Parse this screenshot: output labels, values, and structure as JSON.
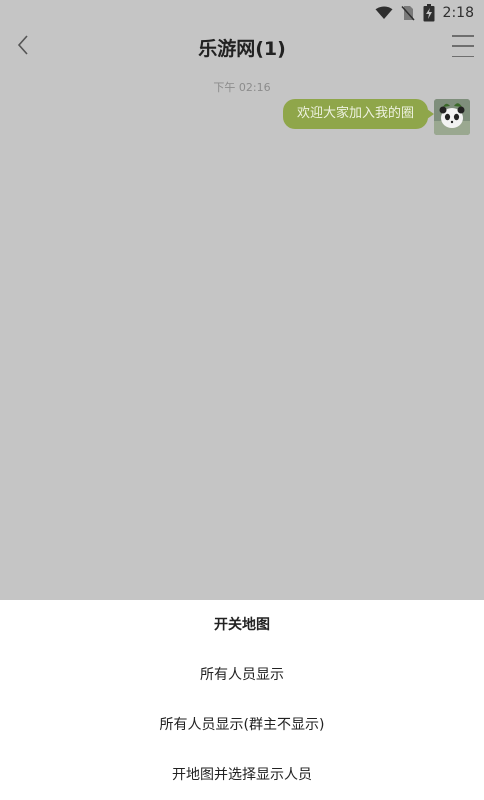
{
  "status_bar": {
    "time": "2:18",
    "icons": [
      "wifi-icon",
      "no-sim-icon",
      "battery-charging-icon"
    ]
  },
  "header": {
    "title": "乐游网(1)",
    "back_icon": "chevron-left-icon",
    "menu_icon": "menu-icon"
  },
  "chat": {
    "timestamp": "下午 02:16",
    "messages": [
      {
        "text": "欢迎大家加入我的圈",
        "from": "self",
        "bubble_color": "#8fa64a"
      }
    ]
  },
  "action_sheet": {
    "items": [
      {
        "label": "开关地图"
      },
      {
        "label": "所有人员显示"
      },
      {
        "label": "所有人员显示(群主不显示)"
      },
      {
        "label": "开地图并选择显示人员"
      }
    ]
  }
}
